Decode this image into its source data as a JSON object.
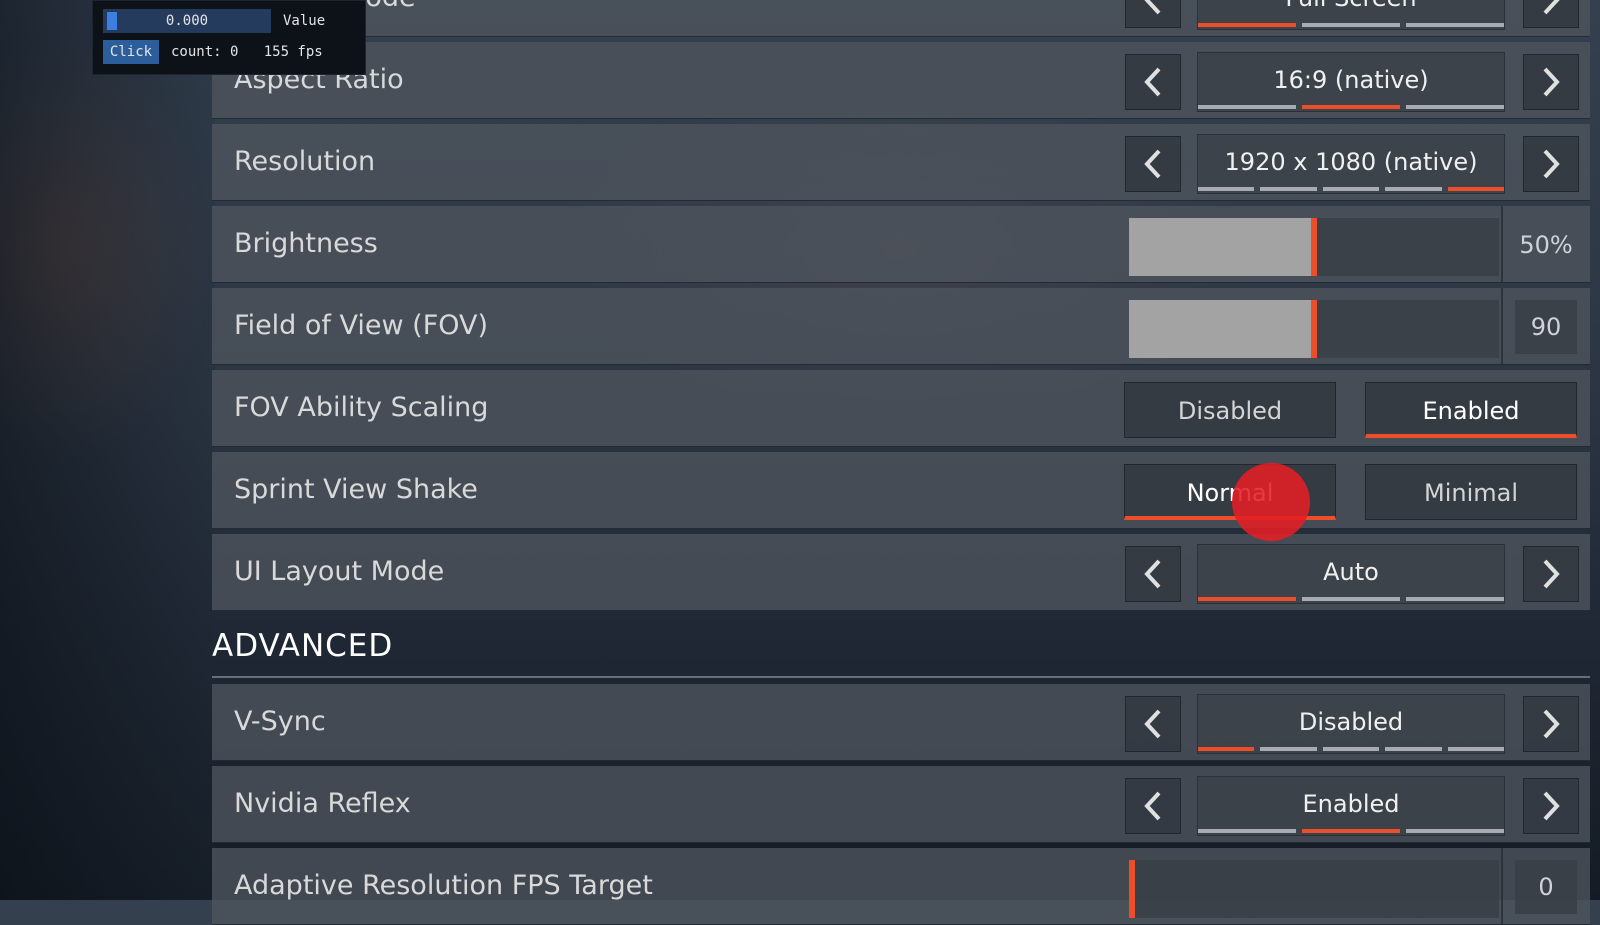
{
  "debug_overlay": {
    "field_value": "0.000",
    "field_label": "Value",
    "click_button": "Click",
    "status": "count: 0   155 fps"
  },
  "rows": {
    "display_mode": {
      "label": "Display Mode",
      "value": "Full Screen",
      "pips": 3,
      "active": 0
    },
    "aspect_ratio": {
      "label": "Aspect Ratio",
      "value": "16:9 (native)",
      "pips": 3,
      "active": 1
    },
    "resolution": {
      "label": "Resolution",
      "value": "1920 x 1080 (native)",
      "pips": 5,
      "active": 4
    },
    "brightness": {
      "label": "Brightness",
      "value": "50%",
      "level": 0.5
    },
    "fov": {
      "label": "Field of View (FOV)",
      "value": "90",
      "level": 0.5
    },
    "fov_ability_scaling": {
      "label": "FOV Ability Scaling",
      "options": [
        "Disabled",
        "Enabled"
      ],
      "selected": 1
    },
    "sprint_view_shake": {
      "label": "Sprint View Shake",
      "options": [
        "Normal",
        "Minimal"
      ],
      "selected": 0
    },
    "ui_layout_mode": {
      "label": "UI Layout Mode",
      "value": "Auto",
      "pips": 3,
      "active": 0
    }
  },
  "advanced": {
    "title": "ADVANCED",
    "vsync": {
      "label": "V-Sync",
      "value": "Disabled",
      "pips": 5,
      "active": 0
    },
    "nvidia_reflex": {
      "label": "Nvidia Reflex",
      "value": "Enabled",
      "pips": 3,
      "active": 1
    },
    "adaptive_fps": {
      "label": "Adaptive Resolution FPS Target",
      "value": "0",
      "level": 0
    }
  },
  "colors": {
    "accent": "#ec4e2a",
    "cursor": "#e41e24"
  }
}
